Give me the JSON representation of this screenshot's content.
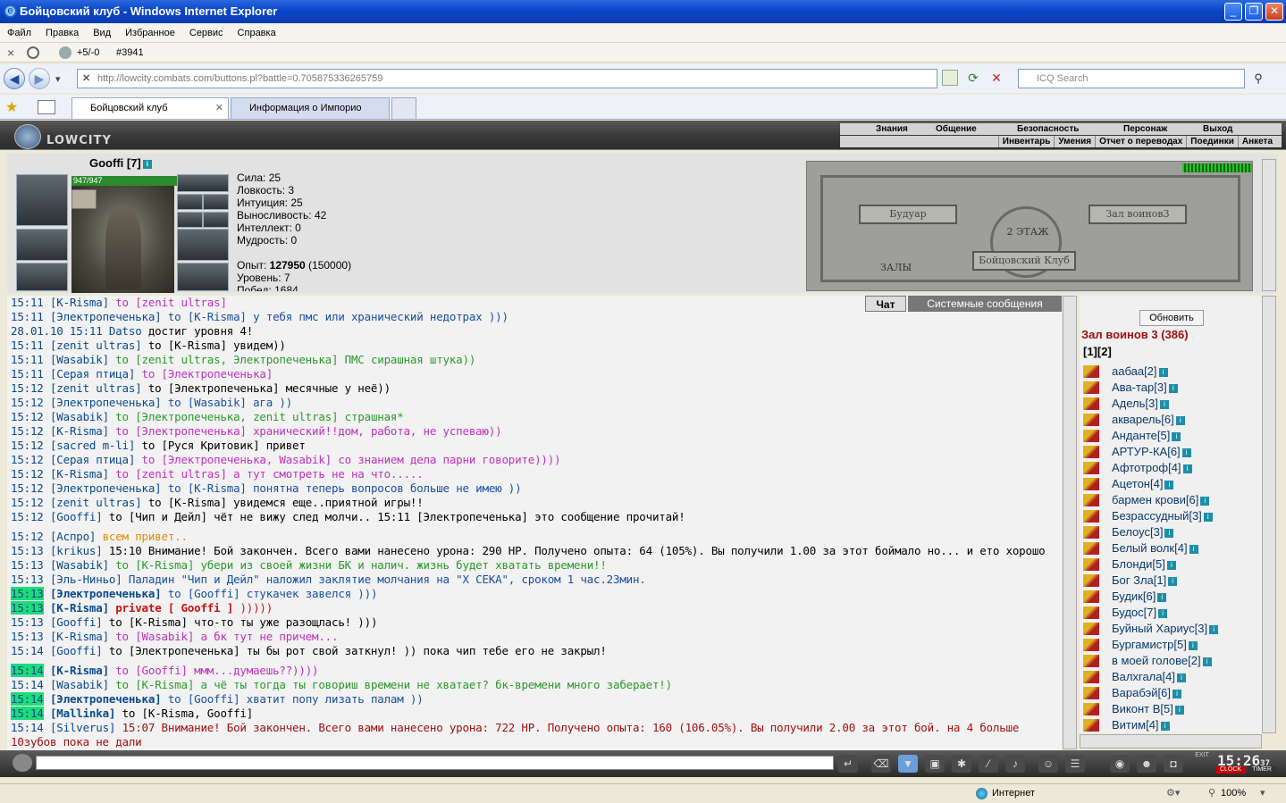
{
  "window": {
    "title": "Бойцовский клуб - Windows Internet Explorer"
  },
  "menu": [
    "Файл",
    "Правка",
    "Вид",
    "Избранное",
    "Сервис",
    "Справка"
  ],
  "toolbar": {
    "close_x": "×",
    "score": "+5/-0",
    "counter": "#3941"
  },
  "address": {
    "url": "http://lowcity.combats.com/buttons.pl?battle=0.705875336265759",
    "search_placeholder": "ICQ Search"
  },
  "tabs": [
    {
      "label": "Бойцовский клуб",
      "active": true
    },
    {
      "label": "Информация о Импорио",
      "active": false
    }
  ],
  "game_nav": {
    "row1": [
      "Знания",
      "Общение",
      "Безопасность",
      "Персонаж",
      "Выход"
    ],
    "row2": [
      "Инвентарь",
      "Умения",
      "Отчет о переводах",
      "Поединки",
      "Анкета"
    ],
    "logo": "LOWCITY"
  },
  "character": {
    "name": "Gooffi [7]",
    "hp": "947/947",
    "stats": [
      "Сила: 25",
      "Ловкость: 3",
      "Интуиция: 25",
      "Выносливость: 42",
      "Интеллект: 0",
      "Мудрость: 0"
    ],
    "exp_label": "Опыт:",
    "exp_value": "127950",
    "exp_next": "(150000)",
    "level": "Уровень: 7",
    "wins": "Побед: 1684"
  },
  "map": {
    "floor": "2 ЭТАЖ",
    "club": "Бойцовский Клуб",
    "boudoir": "Будуар",
    "hall": "Зал воинов3",
    "halls": "ЗАЛЫ"
  },
  "chat_tabs": [
    "Чат",
    "Системные сообщения"
  ],
  "chat": [
    {
      "time": "15:11",
      "name": "[K-Risma]",
      "to": "to [zenit ultras]",
      "msg": "",
      "tc": "#c030c0"
    },
    {
      "time": "15:11",
      "name": "[Электропеченька]",
      "to": "to [K-Risma]",
      "msg": "у тебя пмс или хранический недотрах )))",
      "tc": "#1a4fa0"
    },
    {
      "time": "28.01.10 15:11",
      "name": "Datso",
      "to": "",
      "msg": "достиг уровня 4!",
      "tc": "#000"
    },
    {
      "time": "15:11",
      "name": "[zenit ultras]",
      "to": "to [K-Risma]",
      "msg": "увидем))",
      "tc": "#000"
    },
    {
      "time": "15:11",
      "name": "[Wasabik]",
      "to": "to [zenit ultras, Электропеченька]",
      "msg": "ПМС сирашная штука))",
      "tc": "#2a9a2a"
    },
    {
      "time": "15:11",
      "name": "[Серая птица]",
      "to": "to [Электропеченька]",
      "msg": "",
      "tc": "#c030c0"
    },
    {
      "time": "15:12",
      "name": "[zenit ultras]",
      "to": "to [Электропеченька]",
      "msg": "месячные у неё))",
      "tc": "#000"
    },
    {
      "time": "15:12",
      "name": "[Электропеченька]",
      "to": "to [Wasabik]",
      "msg": "ага ))",
      "tc": "#1a4fa0"
    },
    {
      "time": "15:12",
      "name": "[Wasabik]",
      "to": "to [Электропеченька, zenit ultras]",
      "msg": "страшная*",
      "tc": "#2a9a2a"
    },
    {
      "time": "15:12",
      "name": "[K-Risma]",
      "to": "to [Электропеченька]",
      "msg": "хранический!!дом, работа, не успеваю))",
      "tc": "#c030c0"
    },
    {
      "time": "15:12",
      "name": "[sacred m-li]",
      "to": "to [Руся Критовик]",
      "msg": "привет",
      "tc": "#000"
    },
    {
      "time": "15:12",
      "name": "[Серая птица]",
      "to": "to [Электропеченька, Wasabik]",
      "msg": "со знанием дела парни говорите))))",
      "tc": "#c030c0"
    },
    {
      "time": "15:12",
      "name": "[K-Risma]",
      "to": "to [zenit ultras]",
      "msg": "а тут смотреть не на что.....",
      "tc": "#c030c0"
    },
    {
      "time": "15:12",
      "name": "[Электропеченька]",
      "to": "to [K-Risma]",
      "msg": "понятна теперь вопросов больше не имею ))",
      "tc": "#1a4fa0"
    },
    {
      "time": "15:12",
      "name": "[zenit ultras]",
      "to": "to [K-Risma]",
      "msg": "увидемся еще..приятной игры!!",
      "tc": "#000"
    },
    {
      "time": "15:12",
      "name": "[Gooffi]",
      "to": "to [Чип и Дейл]",
      "msg": "чёт не вижу след молчи.. 15:11 [Электропеченька] это сообщение прочитай!",
      "tc": "#000"
    },
    {
      "time": "15:12",
      "name": "[Аспро]",
      "to": "",
      "msg": "всем привет..",
      "tc": "#e08a00",
      "gap": true
    },
    {
      "time": "15:13",
      "name": "[krikus]",
      "to": "",
      "msg": "15:10 Внимание! Бой закончен. Всего вами нанесено урона: 290 HP. Получено опыта: 64 (105%). Вы получили 1.00 за этот боймало но... и ето хорошо",
      "tc": "#000"
    },
    {
      "time": "15:13",
      "name": "[Wasabik]",
      "to": "to [K-Risma]",
      "msg": "убери из своей жизни БК и налич. жизнь будет хватать времени!!",
      "tc": "#2a9a2a"
    },
    {
      "time": "15:13",
      "name": "[Эль-Ниньо]",
      "to": "",
      "msg": "Паладин \"Чип и Дейл\" наложил заклятие молчания на \"X СЕКА\", сроком 1 час.23мин.",
      "tc": "#1a4fa0"
    },
    {
      "time": "15:13",
      "name": "[Электропеченька]",
      "to": "to [Gooffi]",
      "msg": "стукачек завелся )))",
      "tc": "#1a4fa0",
      "hl": true
    },
    {
      "time": "15:13",
      "name": "[K-Risma]",
      "to": "private [ Gooffi ]",
      "msg": ")))))",
      "tc": "#d01010",
      "hl": true
    },
    {
      "time": "15:13",
      "name": "[Gooffi]",
      "to": "to [K-Risma]",
      "msg": "что-то ты уже разощлась! )))",
      "tc": "#000"
    },
    {
      "time": "15:13",
      "name": "[K-Risma]",
      "to": "to [Wasabik]",
      "msg": "а бк тут не причем...",
      "tc": "#c030c0"
    },
    {
      "time": "15:14",
      "name": "[Gooffi]",
      "to": "to [Электропеченька]",
      "msg": "ты бы рот свой заткнул! )) пока чип тебе его не закрыл!",
      "tc": "#000"
    },
    {
      "time": "15:14",
      "name": "[K-Risma]",
      "to": "to [Gooffi]",
      "msg": "ммм...думаешь??))))",
      "tc": "#c030c0",
      "hl": true,
      "gap": true
    },
    {
      "time": "15:14",
      "name": "[Wasabik]",
      "to": "to [K-Risma]",
      "msg": "а чё ты тогда ты говориш времени не хватает? бк-времени много заберает!)",
      "tc": "#2a9a2a"
    },
    {
      "time": "15:14",
      "name": "[Электропеченька]",
      "to": "to [Gooffi]",
      "msg": "хватит попу лизать палам ))",
      "tc": "#1a4fa0",
      "hl": true
    },
    {
      "time": "15:14",
      "name": "[Mallinka]",
      "to": "to [K-Risma, Gooffi]",
      "msg": "",
      "tc": "#000",
      "hl": true
    },
    {
      "time": "15:14",
      "name": "[Silverus]",
      "to": "",
      "msg": "15:07 Внимание! Бой закончен. Всего вами нанесено урона: 722 HP. Получено опыта: 160 (106.05%). Вы получили 2.00 за этот бой. на 4 больше",
      "tc": "#a01010"
    },
    {
      "time": "",
      "name": "",
      "to": "",
      "msg": "10зубов пока не дали",
      "tc": "#a01010"
    }
  ],
  "players_panel": {
    "refresh": "Обновить",
    "title": "Зал воинов 3 (386)",
    "pages": "[1][2]",
    "players": [
      "аабаа[2]",
      "Ава-тар[3]",
      "Адель[3]",
      "акварель[6]",
      "Анданте[5]",
      "АРТУР-КА[6]",
      "Афтотроф[4]",
      "Ацетон[4]",
      "бармен крови[6]",
      "Безрассудный[3]",
      "Белоус[3]",
      "Белый волк[4]",
      "Блонди[5]",
      "Бог Зла[1]",
      "Будик[6]",
      "Будос[7]",
      "Буйный Хариус[3]",
      "Бургамистр[5]",
      "в моей голове[2]",
      "Валхгала[4]",
      "Варабэй[6]",
      "Виконт В[5]",
      "Витим[4]"
    ]
  },
  "clock": {
    "time": "15:26",
    "seconds": "37",
    "label1": "CLOCK",
    "label2": "TIMER",
    "exit": "EXIT"
  },
  "status": {
    "zone": "Интернет",
    "zoom": "100%"
  }
}
